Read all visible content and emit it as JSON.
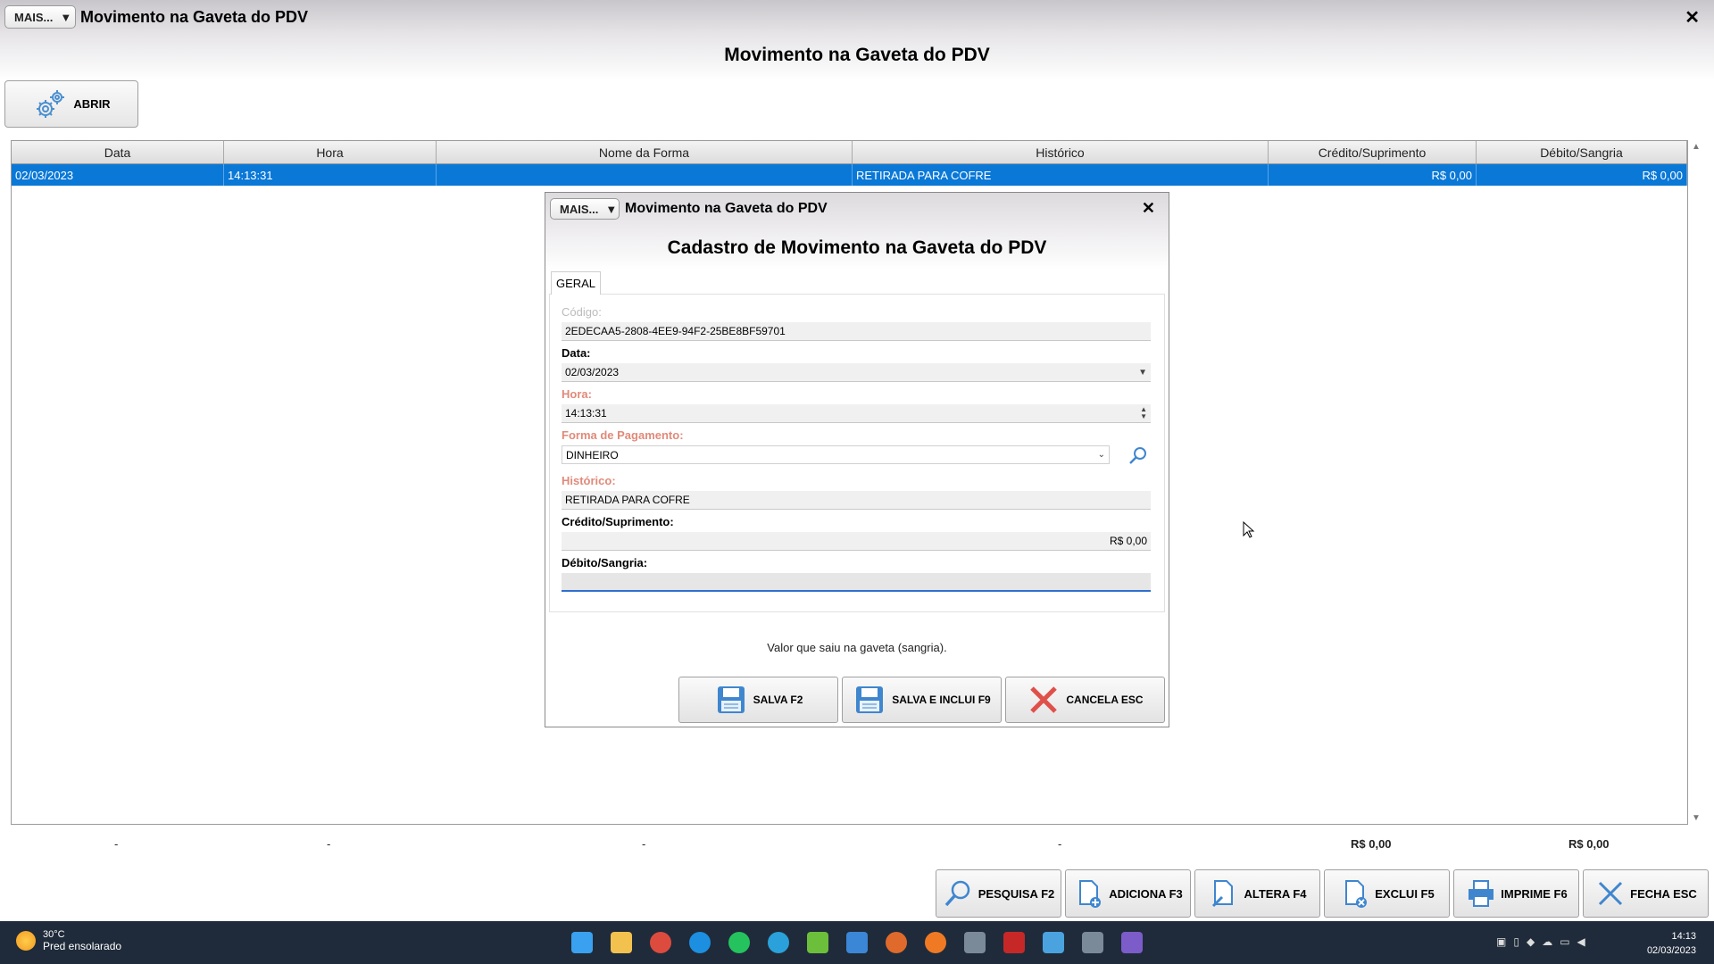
{
  "window": {
    "mais_label": "MAIS...",
    "title": "Movimento na Gaveta do PDV",
    "close_symbol": "✕",
    "heading": "Movimento na Gaveta do PDV"
  },
  "toolbar_top": {
    "abrir_label": "ABRIR",
    "abrir_icon": "gears-icon"
  },
  "grid": {
    "columns": [
      "Data",
      "Hora",
      "Nome da Forma",
      "Histórico",
      "Crédito/Suprimento",
      "Débito/Sangria"
    ],
    "rows": [
      {
        "data": "02/03/2023",
        "hora": "14:13:31",
        "nome_forma": "",
        "historico": "RETIRADA PARA COFRE",
        "credito": "R$ 0,00",
        "debito": "R$ 0,00",
        "selected": true
      }
    ],
    "totals": {
      "data": "-",
      "hora": "-",
      "nome_forma": "-",
      "historico": "-",
      "credito": "R$ 0,00",
      "debito": "R$ 0,00"
    }
  },
  "bottom_toolbar": [
    {
      "label": "PESQUISA F2",
      "icon": "search-icon"
    },
    {
      "label": "ADICIONA F3",
      "icon": "add-document-icon"
    },
    {
      "label": "ALTERA F4",
      "icon": "edit-document-icon"
    },
    {
      "label": "EXCLUI F5",
      "icon": "delete-document-icon"
    },
    {
      "label": "IMPRIME F6",
      "icon": "printer-icon"
    },
    {
      "label": "FECHA ESC",
      "icon": "close-icon"
    }
  ],
  "dialog": {
    "mais_label": "MAIS...",
    "title": "Movimento na Gaveta do PDV",
    "close_symbol": "✕",
    "heading": "Cadastro de Movimento na Gaveta do PDV",
    "tab": "GERAL",
    "fields": {
      "codigo": {
        "label": "Código:",
        "value": "2EDECAA5-2808-4EE9-94F2-25BE8BF59701"
      },
      "data": {
        "label": "Data:",
        "value": "02/03/2023"
      },
      "hora": {
        "label": "Hora:",
        "value": "14:13:31"
      },
      "forma": {
        "label": "Forma de Pagamento:",
        "value": "DINHEIRO"
      },
      "historico": {
        "label": "Histórico:",
        "value": "RETIRADA PARA COFRE"
      },
      "credito": {
        "label": "Crédito/Suprimento:",
        "value": "R$ 0,00"
      },
      "debito": {
        "label": "Débito/Sangria:",
        "value": ""
      }
    },
    "hint": "Valor que saiu na gaveta (sangria).",
    "buttons": {
      "salva": "SALVA F2",
      "salva_inclui": "SALVA E INCLUI F9",
      "cancela": "CANCELA ESC"
    }
  },
  "taskbar": {
    "weather_temp": "30°C",
    "weather_desc": "Pred ensolarado",
    "time": "14:13",
    "date": "02/03/2023"
  },
  "colors": {
    "selection": "#0a78d7",
    "required_label": "#e08a7a",
    "disabled_label": "#bbbbbb",
    "taskbar": "#1f2b3a"
  }
}
